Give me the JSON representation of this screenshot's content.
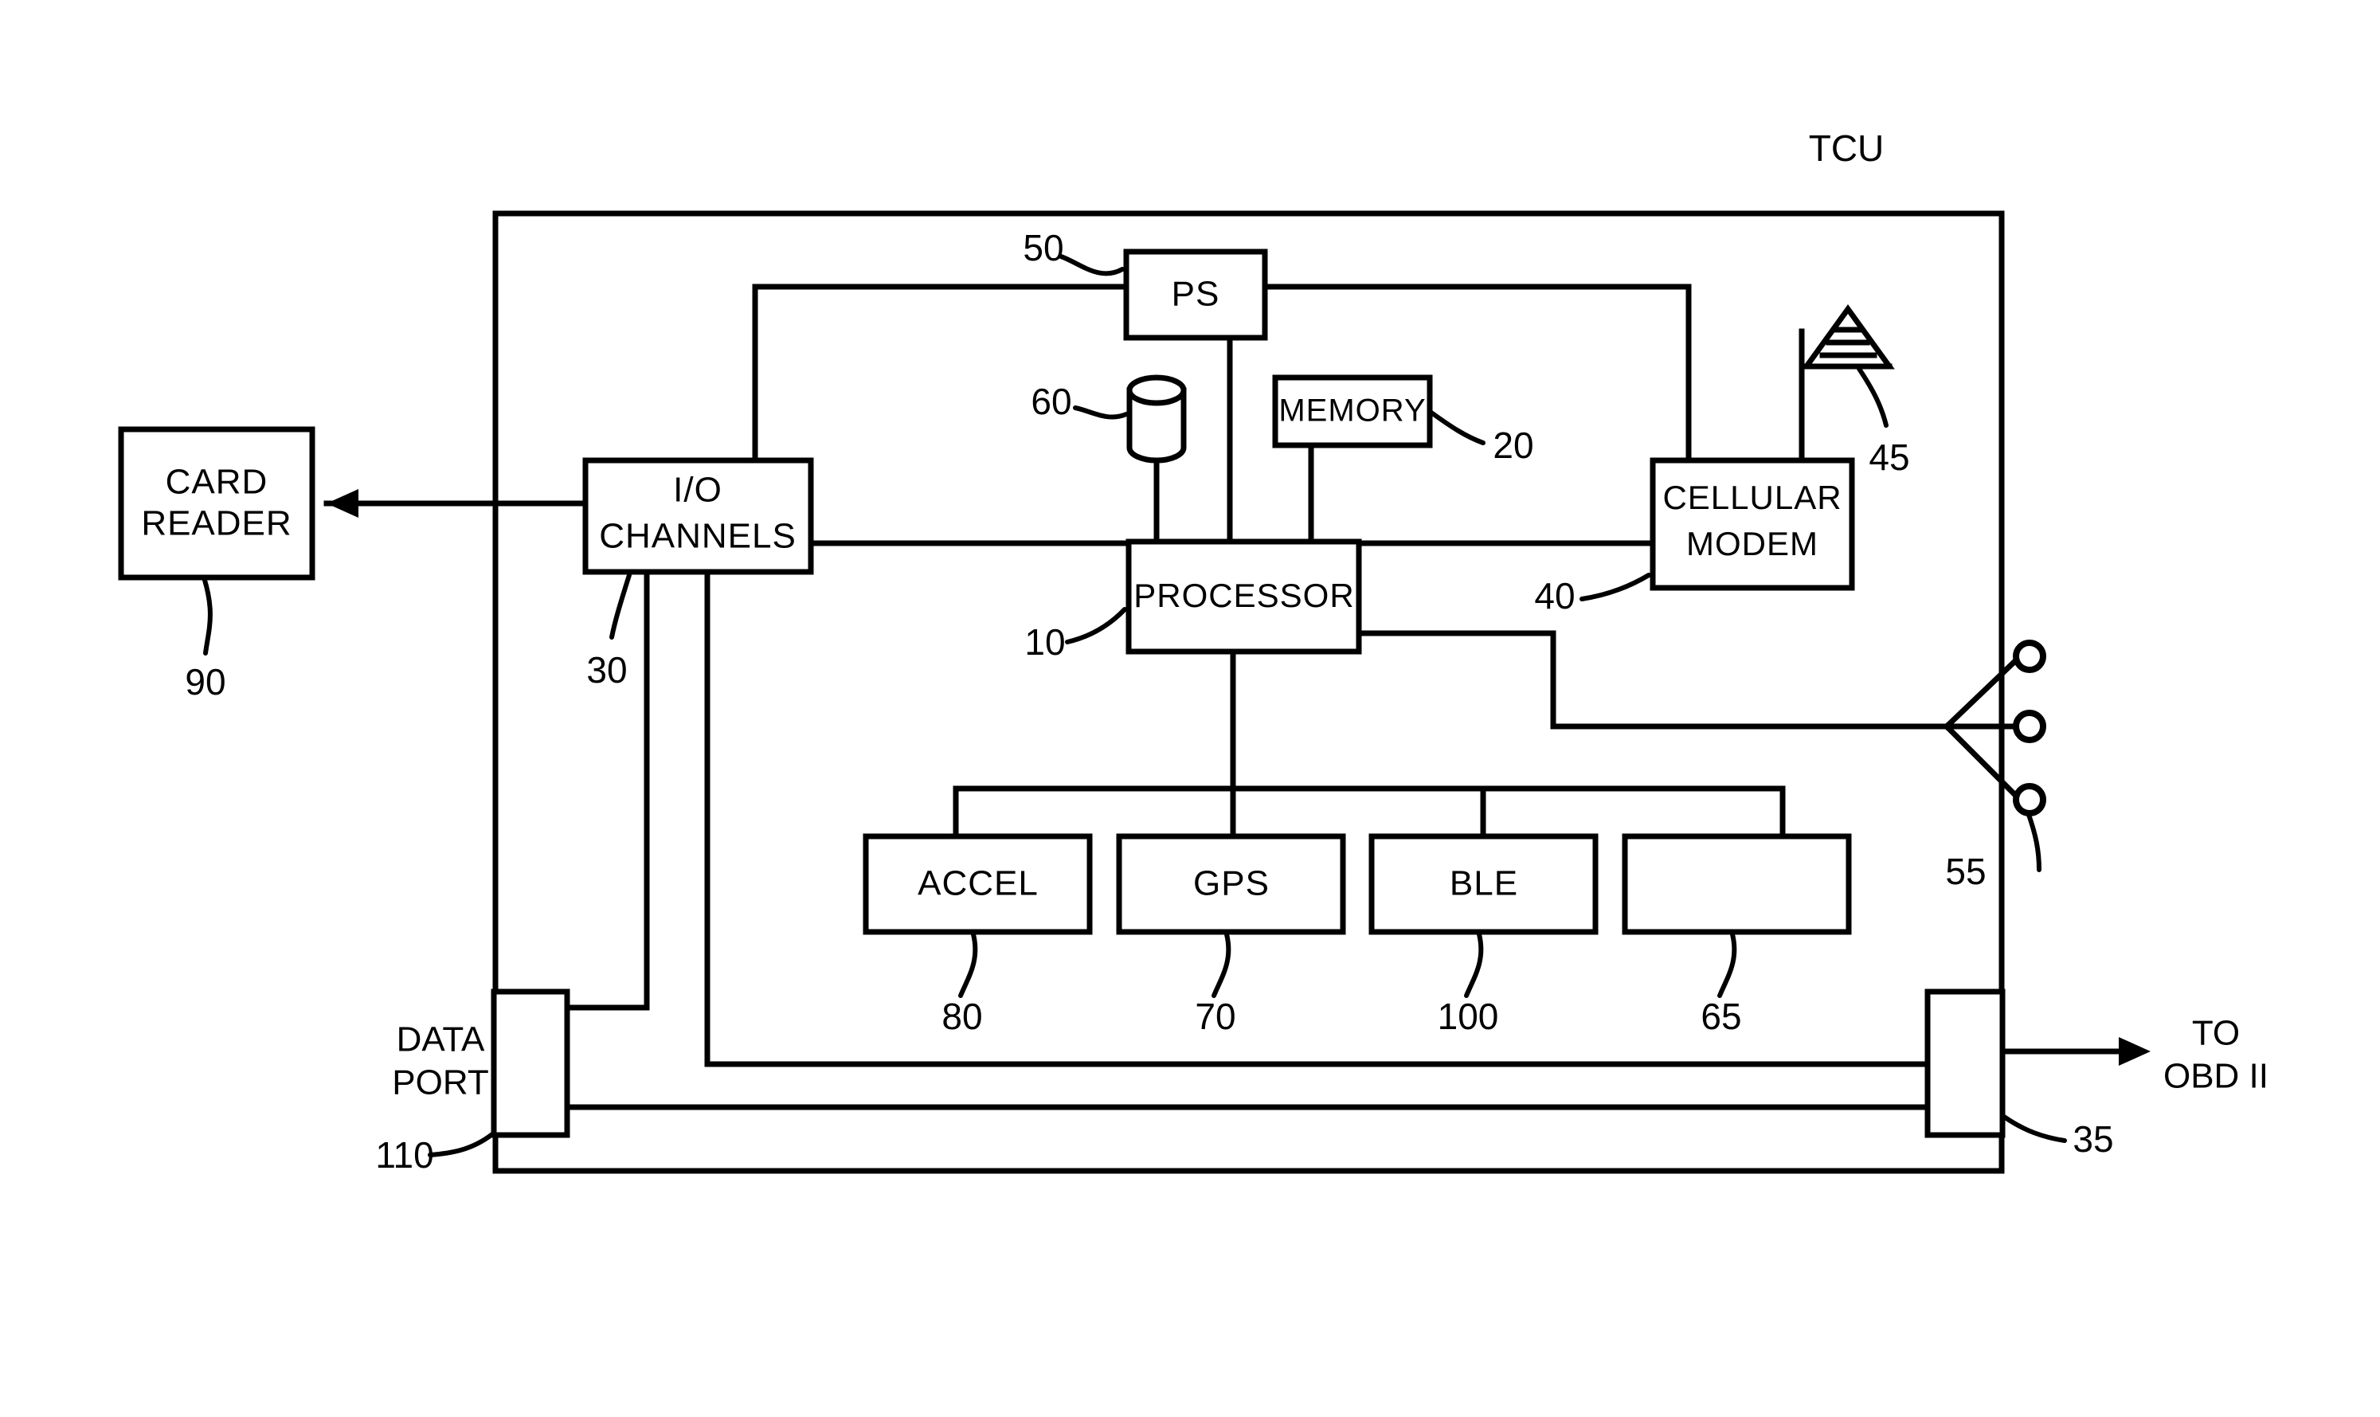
{
  "figure": {
    "type": "patent-block-diagram",
    "title": "TCU",
    "title_position": "top-right"
  },
  "blocks": [
    {
      "id": "card_reader",
      "label_line1": "CARD",
      "label_line2": "READER",
      "ref": "90",
      "inside_tcu": false
    },
    {
      "id": "io_channels",
      "label_line1": "I/O",
      "label_line2": "CHANNELS",
      "ref": "30",
      "inside_tcu": true
    },
    {
      "id": "ps",
      "label_line1": "PS",
      "label_line2": "",
      "ref": "50",
      "inside_tcu": true
    },
    {
      "id": "memory",
      "label_line1": "MEMORY",
      "label_line2": "",
      "ref": "20",
      "inside_tcu": true
    },
    {
      "id": "processor",
      "label_line1": "PROCESSOR",
      "label_line2": "",
      "ref": "10",
      "inside_tcu": true
    },
    {
      "id": "cellular_modem",
      "label_line1": "CELLULAR",
      "label_line2": "MODEM",
      "ref": "40",
      "inside_tcu": true
    },
    {
      "id": "accel",
      "label_line1": "ACCEL",
      "label_line2": "",
      "ref": "80",
      "inside_tcu": true
    },
    {
      "id": "gps",
      "label_line1": "GPS",
      "label_line2": "",
      "ref": "70",
      "inside_tcu": true
    },
    {
      "id": "ble",
      "label_line1": "BLE",
      "label_line2": "",
      "ref": "100",
      "inside_tcu": true
    },
    {
      "id": "spare",
      "label_line1": "",
      "label_line2": "",
      "ref": "65",
      "inside_tcu": true
    }
  ],
  "symbols": [
    {
      "id": "battery",
      "shape": "cylinder",
      "ref": "60"
    },
    {
      "id": "antenna",
      "shape": "striped-triangle",
      "ref": "45"
    },
    {
      "id": "connector_fanout",
      "shape": "three-way-terminal",
      "ref": "55"
    },
    {
      "id": "data_port",
      "shape": "port-rectangle",
      "ref": "110",
      "label_line1": "DATA",
      "label_line2": "PORT"
    },
    {
      "id": "obd_connector",
      "shape": "port-rectangle",
      "ref": "35",
      "label_line1": "",
      "label_line2": ""
    }
  ],
  "annotations": {
    "tcu_label": "TCU",
    "data_port_label_line1": "DATA",
    "data_port_label_line2": "PORT",
    "obd_label_line1": "TO",
    "obd_label_line2": "OBD II"
  },
  "reference_numerals": {
    "processor": "10",
    "memory": "20",
    "io_channels": "30",
    "obd_connector": "35",
    "cellular_modem": "40",
    "antenna": "45",
    "ps": "50",
    "connector_fanout": "55",
    "battery": "60",
    "spare_module": "65",
    "gps": "70",
    "accel": "80",
    "card_reader": "90",
    "ble": "100",
    "data_port": "110"
  },
  "colors": {
    "line": "#000000",
    "background": "#ffffff",
    "text": "#000000"
  }
}
